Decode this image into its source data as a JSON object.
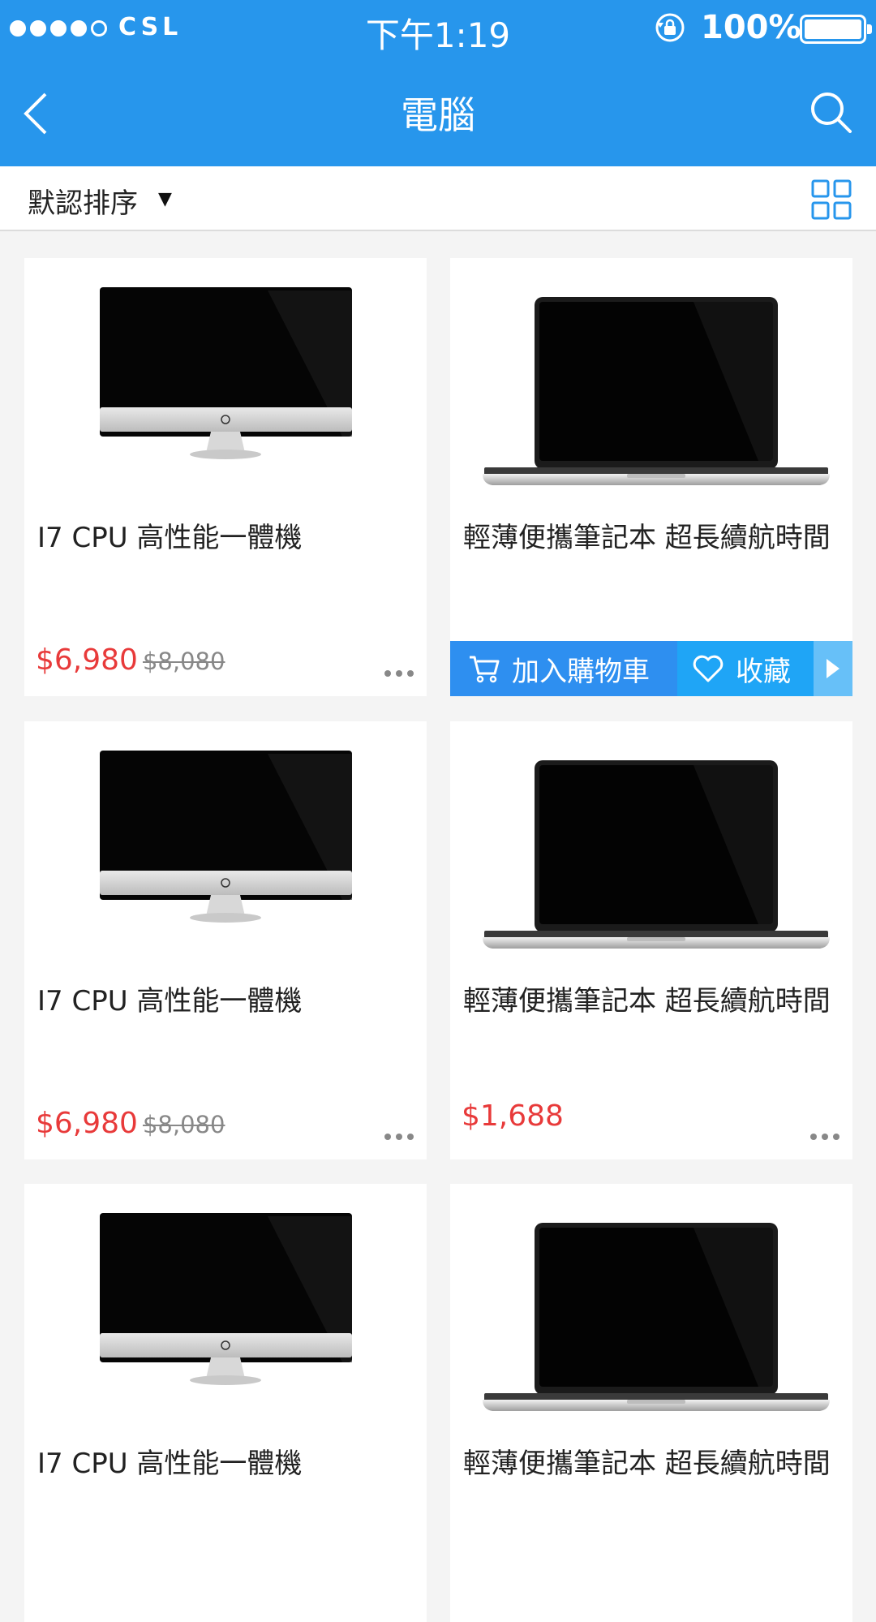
{
  "status_bar": {
    "carrier": "CSL",
    "time": "下午1:19",
    "battery_percent": "100%",
    "signal_bars": 4
  },
  "nav": {
    "title": "電腦",
    "back_icon": "chevron-left-icon",
    "search_icon": "search-icon"
  },
  "sort_bar": {
    "label": "默認排序",
    "caret": "▼",
    "view_icon": "grid-view-icon"
  },
  "theme": {
    "primary": "#2796ec",
    "price_red": "#e83a3a"
  },
  "products": [
    {
      "title": "I7 CPU 高性能一體機",
      "price": "$6,980",
      "original_price": "$8,080",
      "image": "desktop-monitor"
    },
    {
      "title": "輕薄便攜筆記本 超長續航時間",
      "price": "",
      "original_price": "",
      "image": "laptop",
      "actions": {
        "add_to_cart": "加入購物車",
        "favorite": "收藏"
      }
    },
    {
      "title": "I7 CPU 高性能一體機",
      "price": "$6,980",
      "original_price": "$8,080",
      "image": "desktop-monitor"
    },
    {
      "title": "輕薄便攜筆記本 超長續航時間",
      "price": "$1,688",
      "original_price": "",
      "image": "laptop"
    },
    {
      "title": "I7 CPU 高性能一體機",
      "price": "",
      "original_price": "",
      "image": "desktop-monitor"
    },
    {
      "title": "輕薄便攜筆記本 超長續航時間",
      "price": "",
      "original_price": "",
      "image": "laptop"
    }
  ]
}
